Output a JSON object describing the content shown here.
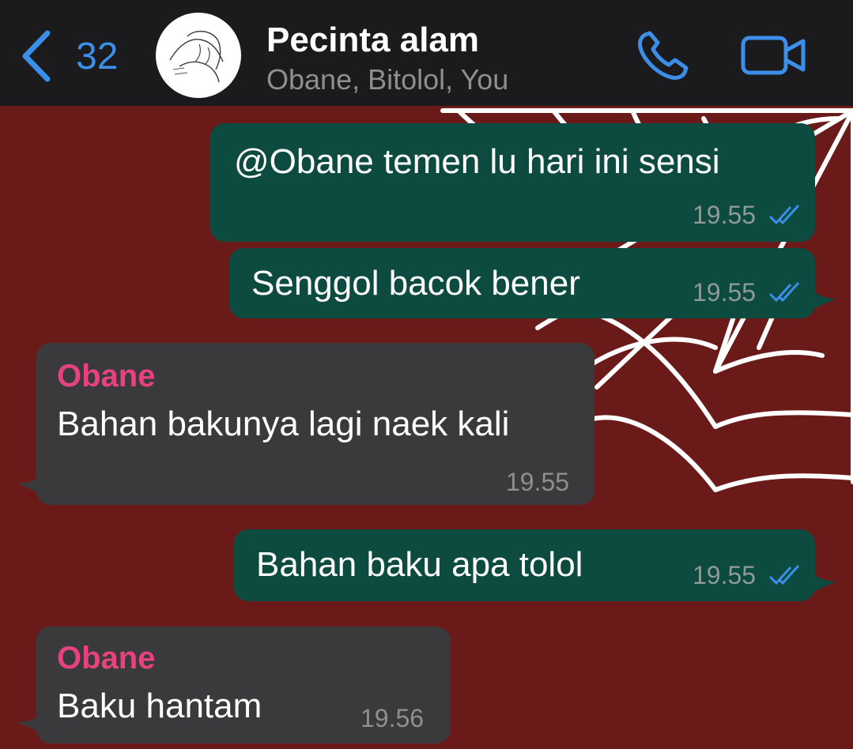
{
  "header": {
    "back_count": "32",
    "title": "Pecinta alam",
    "subtitle": "Obane, Bitolol, You",
    "accent_color": "#3b8fe8",
    "icons": [
      "chevron-left-icon",
      "phone-icon",
      "video-camera-icon"
    ]
  },
  "messages": [
    {
      "direction": "outgoing",
      "text": "@Obane temen lu hari ini sensi",
      "time": "19.55",
      "status": "read"
    },
    {
      "direction": "outgoing",
      "text": "Senggol bacok bener",
      "time": "19.55",
      "status": "read"
    },
    {
      "direction": "incoming",
      "sender": "Obane",
      "text": "Bahan bakunya lagi naek kali",
      "time": "19.55"
    },
    {
      "direction": "outgoing",
      "text": "Bahan baku apa tolol",
      "time": "19.55",
      "status": "read"
    },
    {
      "direction": "incoming",
      "sender": "Obane",
      "text": "Baku hantam",
      "time": "19.56"
    }
  ],
  "colors": {
    "chat_background": "#6b1a1a",
    "outgoing_bubble": "#0d4a3f",
    "incoming_bubble": "#3a3a3c",
    "sender_name": "#e8427e",
    "read_ticks": "#3b8fe8"
  }
}
